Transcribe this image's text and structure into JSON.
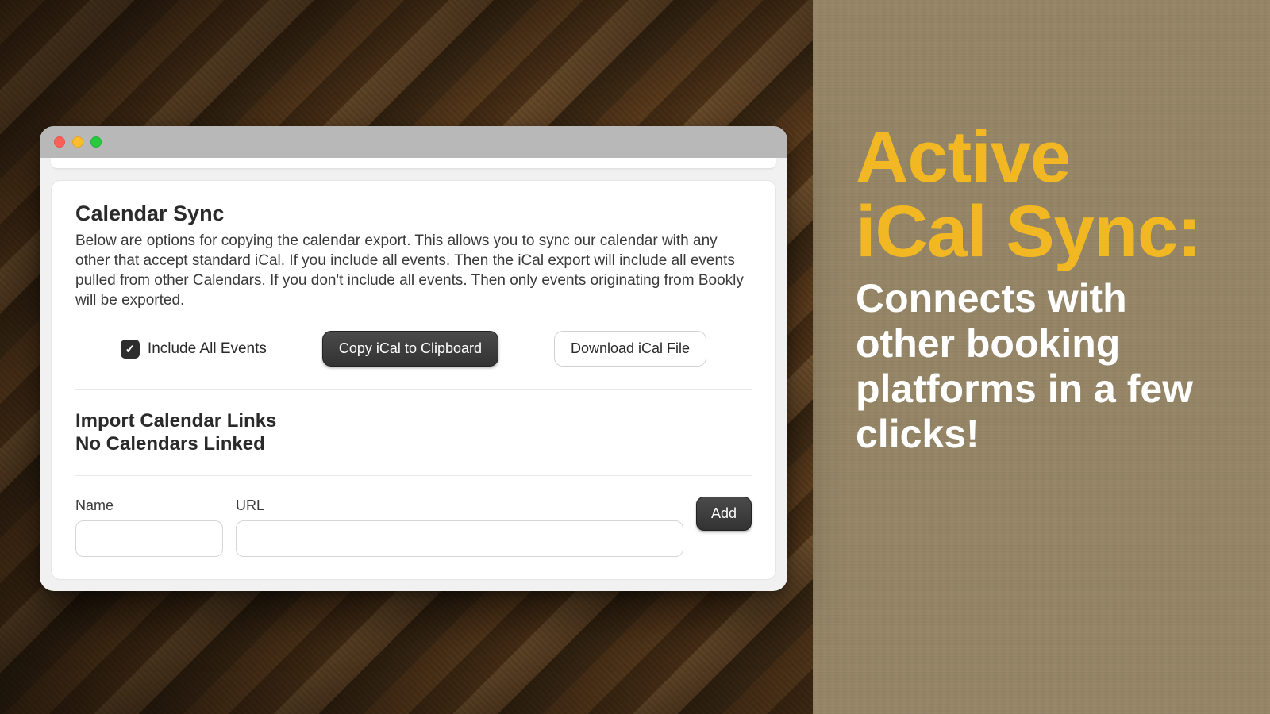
{
  "promo": {
    "headline_line1": "Active",
    "headline_line2": "iCal Sync:",
    "subline": "Connects with other booking platforms in a few clicks!"
  },
  "calendar_sync": {
    "title": "Calendar Sync",
    "description": "Below are options for copying the calendar export. This allows you to sync our calendar with any other that accept standard iCal. If you include all events. Then the iCal export will include all events pulled from other Calendars. If you don't include all events. Then only events originating from Bookly will be exported.",
    "include_all_label": "Include All Events",
    "include_all_checked": true,
    "copy_button": "Copy iCal to Clipboard",
    "download_button": "Download iCal File"
  },
  "import": {
    "title": "Import Calendar Links",
    "empty_state": "No Calendars Linked",
    "name_label": "Name",
    "url_label": "URL",
    "add_button": "Add"
  }
}
